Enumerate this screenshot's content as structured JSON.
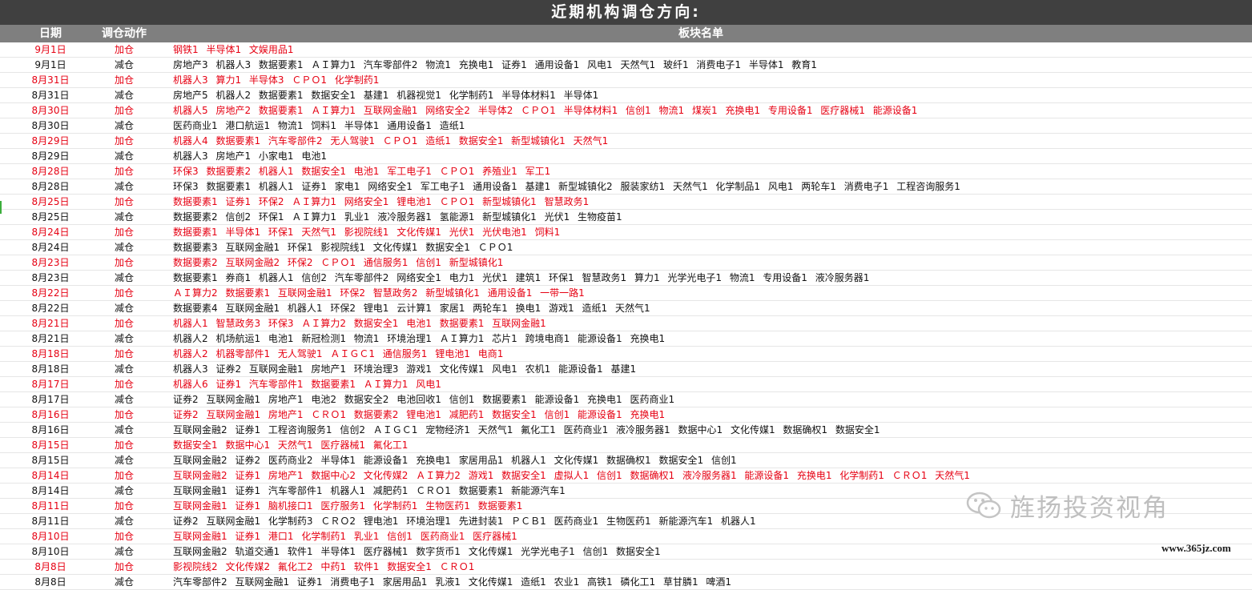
{
  "title": "近期机构调仓方向:",
  "headers": {
    "date": "日期",
    "action": "调仓动作",
    "list": "板块名单"
  },
  "rows": [
    {
      "date": "9月1日",
      "action": "加仓",
      "sectors": "钢铁1 半导体1 文娱用品1"
    },
    {
      "date": "9月1日",
      "action": "减仓",
      "sectors": "房地产3 机器人3 数据要素1 ＡＩ算力1 汽车零部件2 物流1 充换电1 证券1 通用设备1 风电1 天然气1 玻纤1 消费电子1 半导体1 教育1"
    },
    {
      "date": "8月31日",
      "action": "加仓",
      "sectors": "机器人3 算力1 半导体3 ＣＰＯ1 化学制药1"
    },
    {
      "date": "8月31日",
      "action": "减仓",
      "sectors": "房地产5 机器人2 数据要素1 数据安全1 基建1 机器视觉1 化学制药1 半导体材料1 半导体1"
    },
    {
      "date": "8月30日",
      "action": "加仓",
      "sectors": "机器人5 房地产2 数据要素1 ＡＩ算力1 互联网金融1 网络安全2 半导体2 ＣＰＯ1 半导体材料1 信创1 物流1 煤炭1 充换电1 专用设备1 医疗器械1 能源设备1"
    },
    {
      "date": "8月30日",
      "action": "减仓",
      "sectors": "医药商业1 港口航运1 物流1 饲料1 半导体1 通用设备1 造纸1"
    },
    {
      "date": "8月29日",
      "action": "加仓",
      "sectors": "机器人4 数据要素1 汽车零部件2 无人驾驶1 ＣＰＯ1 造纸1 数据安全1 新型城镇化1 天然气1"
    },
    {
      "date": "8月29日",
      "action": "减仓",
      "sectors": "机器人3 房地产1 小家电1 电池1"
    },
    {
      "date": "8月28日",
      "action": "加仓",
      "sectors": "环保3 数据要素2 机器人1 数据安全1 电池1 军工电子1 ＣＰＯ1 养殖业1 军工1"
    },
    {
      "date": "8月28日",
      "action": "减仓",
      "sectors": "环保3 数据要素1 机器人1 证券1 家电1 网络安全1 军工电子1 通用设备1 基建1 新型城镇化2 服装家纺1 天然气1 化学制品1 风电1 两轮车1 消费电子1 工程咨询服务1"
    },
    {
      "date": "8月25日",
      "action": "加仓",
      "sectors": "数据要素1 证券1 环保2 ＡＩ算力1 网络安全1 锂电池1 ＣＰＯ1 新型城镇化1 智慧政务1"
    },
    {
      "date": "8月25日",
      "action": "减仓",
      "sectors": "数据要素2 信创2 环保1 ＡＩ算力1 乳业1 液冷服务器1 氢能源1 新型城镇化1 光伏1 生物疫苗1"
    },
    {
      "date": "8月24日",
      "action": "加仓",
      "sectors": "数据要素1 半导体1 环保1 天然气1 影视院线1 文化传媒1 光伏1 光伏电池1 饲料1"
    },
    {
      "date": "8月24日",
      "action": "减仓",
      "sectors": "数据要素3 互联网金融1 环保1 影视院线1 文化传媒1 数据安全1 ＣＰＯ1"
    },
    {
      "date": "8月23日",
      "action": "加仓",
      "sectors": "数据要素2 互联网金融2 环保2 ＣＰＯ1 通信服务1 信创1 新型城镇化1"
    },
    {
      "date": "8月23日",
      "action": "减仓",
      "sectors": "数据要素1 券商1 机器人1 信创2 汽车零部件2 网络安全1 电力1 光伏1 建筑1 环保1 智慧政务1 算力1 光学光电子1 物流1 专用设备1 液冷服务器1"
    },
    {
      "date": "8月22日",
      "action": "加仓",
      "sectors": "ＡＩ算力2 数据要素1 互联网金融1 环保2 智慧政务2 新型城镇化1 通用设备1 一带一路1"
    },
    {
      "date": "8月22日",
      "action": "减仓",
      "sectors": "数据要素4 互联网金融1 机器人1 环保2 锂电1 云计算1 家居1 两轮车1 换电1 游戏1 造纸1 天然气1"
    },
    {
      "date": "8月21日",
      "action": "加仓",
      "sectors": "机器人1 智慧政务3 环保3 ＡＩ算力2 数据安全1 电池1 数据要素1 互联网金融1"
    },
    {
      "date": "8月21日",
      "action": "减仓",
      "sectors": "机器人2 机场航运1 电池1 新冠检测1 物流1 环境治理1 ＡＩ算力1 芯片1 跨境电商1 能源设备1 充换电1"
    },
    {
      "date": "8月18日",
      "action": "加仓",
      "sectors": "机器人2 机器零部件1 无人驾驶1 ＡＩＧＣ1 通信服务1 锂电池1 电商1"
    },
    {
      "date": "8月18日",
      "action": "减仓",
      "sectors": "机器人3 证券2 互联网金融1 房地产1 环境治理3 游戏1 文化传媒1 风电1 农机1 能源设备1 基建1"
    },
    {
      "date": "8月17日",
      "action": "加仓",
      "sectors": "机器人6 证券1 汽车零部件1 数据要素1 ＡＩ算力1 风电1"
    },
    {
      "date": "8月17日",
      "action": "减仓",
      "sectors": "证券2 互联网金融1 房地产1 电池2 数据安全2 电池回收1 信创1 数据要素1 能源设备1 充换电1 医药商业1"
    },
    {
      "date": "8月16日",
      "action": "加仓",
      "sectors": "证券2 互联网金融1 房地产1 ＣＲＯ1 数据要素2 锂电池1 减肥药1 数据安全1 信创1 能源设备1 充换电1"
    },
    {
      "date": "8月16日",
      "action": "减仓",
      "sectors": "互联网金融2 证券1 工程咨询服务1 信创2 ＡＩＧＣ1 宠物经济1 天然气1 氟化工1 医药商业1 液冷服务器1 数据中心1 文化传媒1 数据确权1 数据安全1"
    },
    {
      "date": "8月15日",
      "action": "加仓",
      "sectors": "数据安全1 数据中心1 天然气1 医疗器械1 氟化工1"
    },
    {
      "date": "8月15日",
      "action": "减仓",
      "sectors": "互联网金融2 证券2 医药商业2 半导体1 能源设备1 充换电1 家居用品1 机器人1 文化传媒1 数据确权1 数据安全1 信创1"
    },
    {
      "date": "8月14日",
      "action": "加仓",
      "sectors": "互联网金融2 证券1 房地产1 数据中心2 文化传媒2 ＡＩ算力2 游戏1 数据安全1 虚拟人1 信创1 数据确权1 液冷服务器1 能源设备1 充换电1 化学制药1 ＣＲＯ1 天然气1"
    },
    {
      "date": "8月14日",
      "action": "减仓",
      "sectors": "互联网金融1 证券1 汽车零部件1 机器人1 减肥药1 ＣＲＯ1 数据要素1 新能源汽车1"
    },
    {
      "date": "8月11日",
      "action": "加仓",
      "sectors": "互联网金融1 证券1 脑机接口1 医疗服务1 化学制药1 生物医药1 数据要素1"
    },
    {
      "date": "8月11日",
      "action": "减仓",
      "sectors": "证券2 互联网金融1 化学制药3 ＣＲＯ2 锂电池1 环境治理1 先进封装1 ＰＣＢ1 医药商业1 生物医药1 新能源汽车1 机器人1"
    },
    {
      "date": "8月10日",
      "action": "加仓",
      "sectors": "互联网金融1 证券1 港口1 化学制药1 乳业1 信创1 医药商业1 医疗器械1"
    },
    {
      "date": "8月10日",
      "action": "减仓",
      "sectors": "互联网金融2 轨道交通1 软件1 半导体1 医疗器械1 数字货币1 文化传媒1 光学光电子1 信创1 数据安全1"
    },
    {
      "date": "8月8日",
      "action": "加仓",
      "sectors": "影视院线2 文化传媒2 氟化工2 中药1 软件1 数据安全1 ＣＲＯ1"
    },
    {
      "date": "8月8日",
      "action": "减仓",
      "sectors": "汽车零部件2 互联网金融1 证券1 消费电子1 家居用品1 乳液1 文化传媒1 造纸1 农业1 高铁1 磷化工1 草甘膦1 啤酒1"
    }
  ],
  "watermark": "旌扬投资视角",
  "site": "www.365jz.com",
  "colors": {
    "add": "#e60012",
    "reduce": "#111111",
    "title_bg": "#404040",
    "header_bg": "#7f7f7f"
  }
}
